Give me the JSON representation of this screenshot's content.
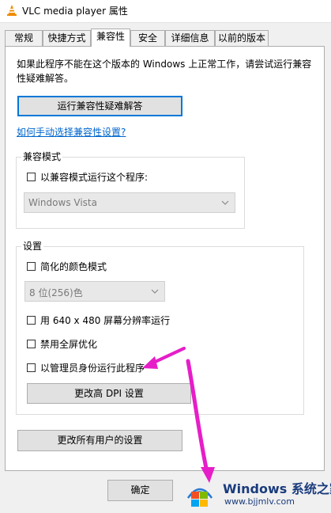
{
  "window": {
    "title": "VLC media player 属性"
  },
  "tabs": [
    {
      "label": "常规",
      "active": false
    },
    {
      "label": "快捷方式",
      "active": false
    },
    {
      "label": "兼容性",
      "active": true
    },
    {
      "label": "安全",
      "active": false
    },
    {
      "label": "详细信息",
      "active": false
    },
    {
      "label": "以前的版本",
      "active": false
    }
  ],
  "compat": {
    "description": "如果此程序不能在这个版本的 Windows 上正常工作，请尝试运行兼容性疑难解答。",
    "troubleshoot_button": "运行兼容性疑难解答",
    "manual_link": "如何手动选择兼容性设置?"
  },
  "compat_mode": {
    "legend": "兼容模式",
    "checkbox_label": "以兼容模式运行这个程序:",
    "checked": false,
    "os_select": "Windows Vista"
  },
  "settings": {
    "legend": "设置",
    "reduced_color_label": "简化的颜色模式",
    "reduced_color_checked": false,
    "color_select": "8 位(256)色",
    "res_label": "用 640 x 480 屏幕分辨率运行",
    "res_checked": false,
    "fullscreen_label": "禁用全屏优化",
    "fullscreen_checked": false,
    "admin_label": "以管理员身份运行此程序",
    "admin_checked": false,
    "dpi_button": "更改高 DPI 设置"
  },
  "all_users_button": "更改所有用户的设置",
  "footer": {
    "ok_button": "确定"
  },
  "watermark": {
    "title": "Windows 系统之家",
    "url": "www.bjjmlv.com"
  },
  "colors": {
    "accent": "#0078d7",
    "link": "#0066cc",
    "annotation_arrow": "#e61ec8"
  },
  "icons": [
    "vlc-cone-icon",
    "checkbox-icon",
    "chevron-down-icon",
    "windows-logo-icon",
    "arrow-annotation"
  ]
}
